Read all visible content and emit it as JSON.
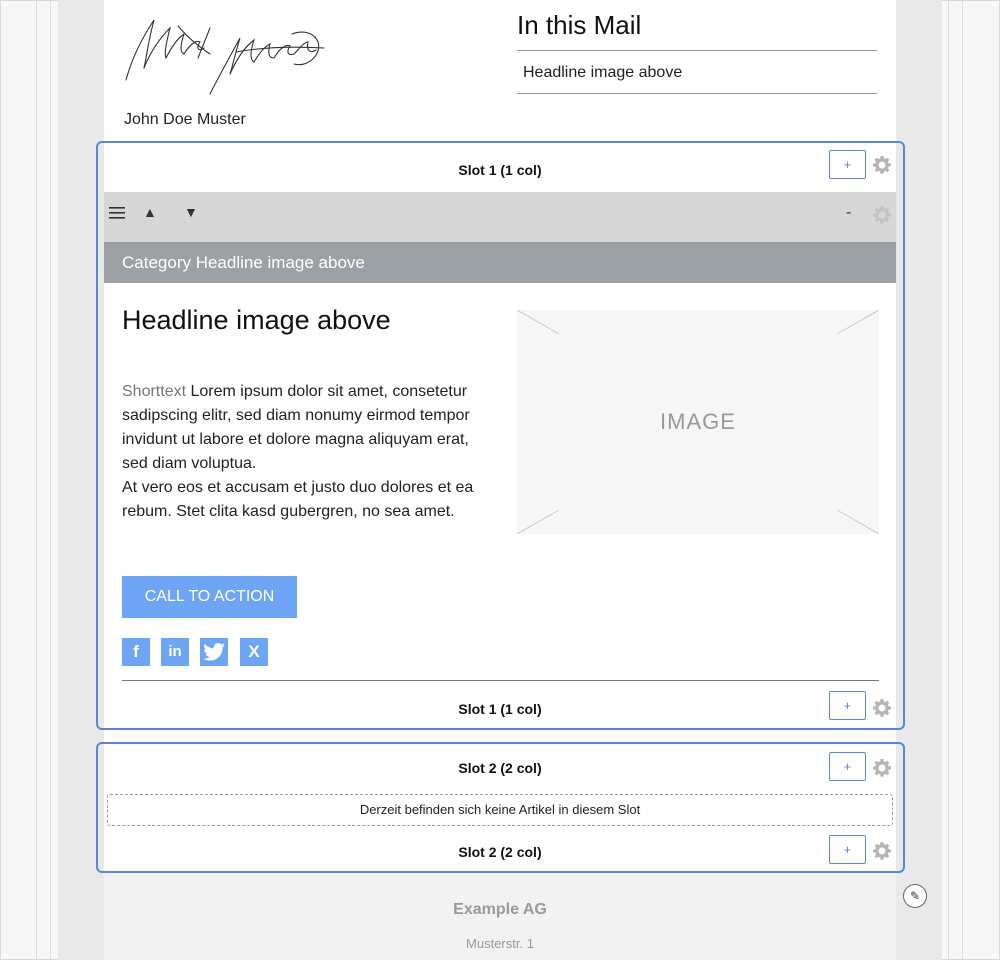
{
  "header": {
    "signer_name": "John Doe Muster",
    "toc_title": "In this Mail",
    "toc_items": [
      "Headline image above"
    ]
  },
  "slot1": {
    "top_label": "Slot 1 (1 col)",
    "bottom_label": "Slot 1 (1 col)",
    "add_label": "+",
    "toolbar": {
      "menu_icon": "hamburger-icon",
      "up_glyph": "▲",
      "down_glyph": "▼",
      "collapse_label": "-"
    },
    "article": {
      "category": "Category Headline image above",
      "headline": "Headline image above",
      "shorttext_label": "Shorttext",
      "body_1": "Lorem ipsum dolor sit amet, consetetur sadipscing elitr, sed diam nonumy eirmod tempor invidunt ut labore et dolore magna aliquyam erat, sed diam voluptua.",
      "body_2": "At vero eos et accusam et justo duo dolores et ea rebum. Stet clita kasd gubergren, no sea amet.",
      "image_label": "IMAGE",
      "cta_label": "CALL TO ACTION",
      "social": [
        {
          "icon": "facebook-icon",
          "glyph": "f"
        },
        {
          "icon": "linkedin-icon",
          "glyph": "in"
        },
        {
          "icon": "twitter-icon",
          "glyph": "t"
        },
        {
          "icon": "xing-icon",
          "glyph": "X"
        }
      ]
    }
  },
  "slot2": {
    "top_label": "Slot 2 (2 col)",
    "bottom_label": "Slot 2 (2 col)",
    "add_label": "+",
    "empty_message": "Derzeit befinden sich keine Artikel in diesem Slot"
  },
  "footer": {
    "company": "Example AG",
    "address": "Musterstr. 1"
  },
  "colors": {
    "slot_border": "#5b87d6",
    "cta": "#6ea6f5",
    "category_bar": "#9ca1a6",
    "toolbar": "#d7d7d7"
  }
}
